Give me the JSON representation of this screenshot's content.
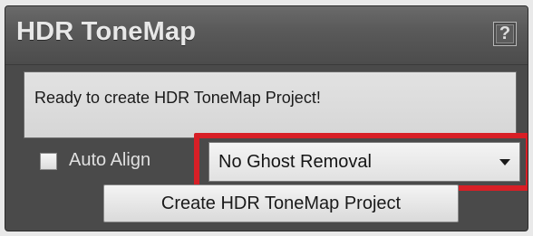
{
  "window": {
    "title": "HDR ToneMap",
    "help_label": "?"
  },
  "status": {
    "text": "Ready to create HDR ToneMap Project!"
  },
  "options": {
    "auto_align_label": "Auto Align",
    "auto_align_checked": false,
    "ghost_removal_selected": "No Ghost Removal"
  },
  "actions": {
    "create_label": "Create HDR ToneMap Project"
  },
  "colors": {
    "panel": "#4a4a4a",
    "highlight": "#d81f26"
  },
  "icons": {
    "help": "help-icon",
    "dropdown": "chevron-down-icon"
  }
}
